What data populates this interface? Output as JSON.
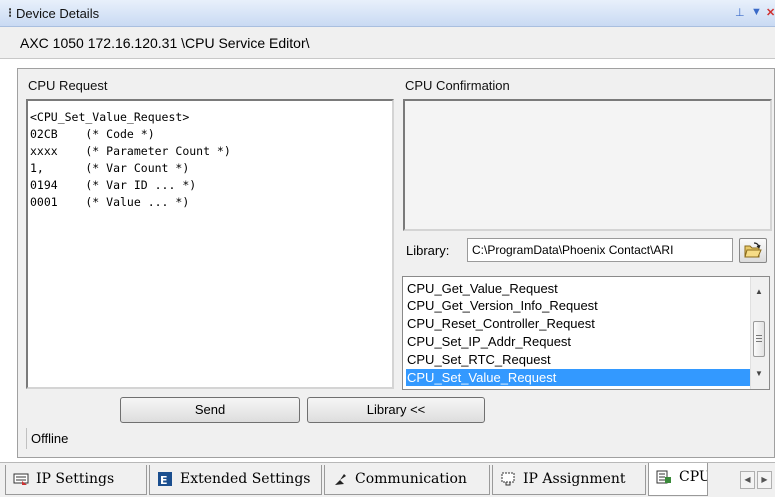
{
  "window": {
    "title": "Device Details",
    "path": "AXC 1050 172.16.120.31 \\CPU Service Editor\\"
  },
  "request": {
    "label": "CPU Request",
    "lines": [
      "<CPU_Set_Value_Request>",
      "02CB    (* Code *)",
      "xxxx    (* Parameter Count *)",
      "1,      (* Var Count *)",
      "0194    (* Var ID ... *)",
      "0001    (* Value ... *)"
    ]
  },
  "confirmation": {
    "label": "CPU Confirmation",
    "text": ""
  },
  "library": {
    "label": "Library:",
    "path": "C:\\ProgramData\\Phoenix Contact\\ARI",
    "browse_icon": "folder-open-icon",
    "items": [
      "CPU_Get_Value_Request",
      "CPU_Get_Version_Info_Request",
      "CPU_Reset_Controller_Request",
      "CPU_Set_IP_Addr_Request",
      "CPU_Set_RTC_Request",
      "CPU_Set_Value_Request"
    ],
    "selected": "CPU_Set_Value_Request"
  },
  "buttons": {
    "send": "Send",
    "library": "Library <<"
  },
  "status": "Offline",
  "tabs": [
    {
      "label": "IP Settings",
      "icon": "network-settings-icon"
    },
    {
      "label": "Extended Settings",
      "icon": "extended-settings-icon"
    },
    {
      "label": "Communication",
      "icon": "plug-icon"
    },
    {
      "label": "IP Assignment",
      "icon": "ip-assignment-icon"
    },
    {
      "label": "CPU",
      "icon": "cpu-service-icon"
    }
  ],
  "colors": {
    "selection": "#3399ff",
    "title_gradient_top": "#e8f0fb",
    "title_gradient_bottom": "#c9daf3"
  }
}
